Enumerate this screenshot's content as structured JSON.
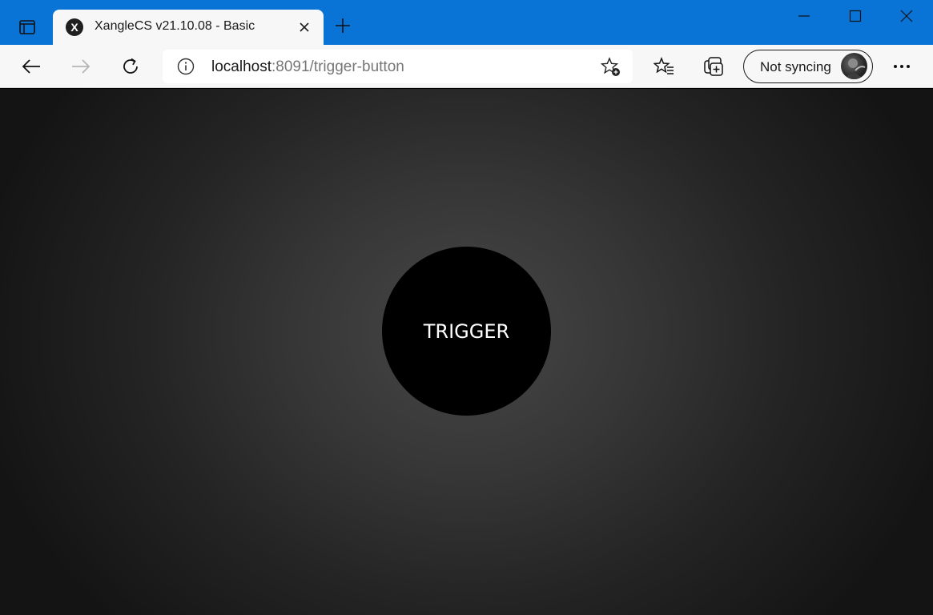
{
  "browser": {
    "tab": {
      "favicon": "X",
      "title": "XangleCS v21.10.08 - Basic"
    },
    "address": {
      "host": "localhost",
      "rest": ":8091/trigger-button"
    },
    "profile": {
      "label": "Not syncing"
    },
    "colors": {
      "titlebar": "#0a74d6",
      "toolbar": "#f7f7f7"
    }
  },
  "page": {
    "trigger_label": "TRIGGER"
  }
}
